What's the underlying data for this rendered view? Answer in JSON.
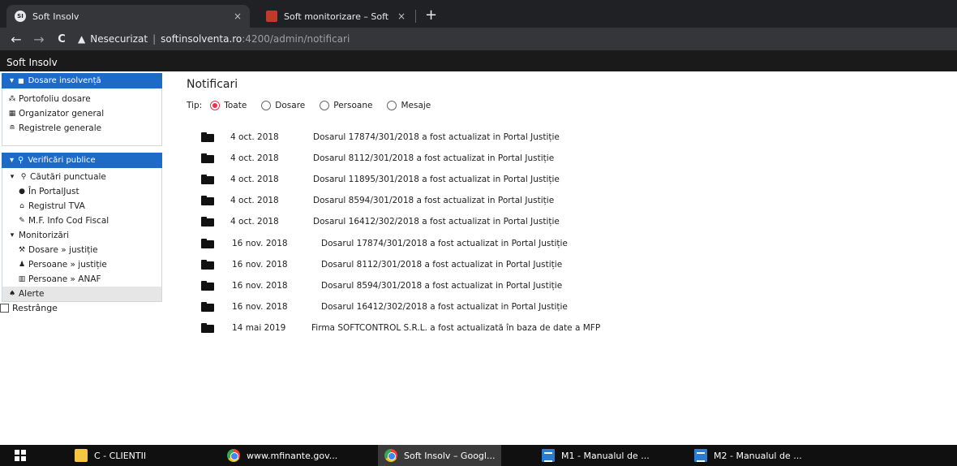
{
  "browser": {
    "tabs": [
      {
        "label": "Soft Insolv",
        "favicon": "softinsolv-favicon",
        "active": true
      },
      {
        "label": "Soft monitorizare – Soft Insolvent",
        "favicon": "monitor-favicon",
        "active": false
      }
    ],
    "new_tab": "+",
    "tab_close": "×",
    "back": "←",
    "forward": "→",
    "reload": "C",
    "security_label": "Nesecurizat",
    "url_host": "softinsolventa.ro",
    "url_path": ":4200/admin/notificari"
  },
  "app": {
    "title": "Soft Insolv"
  },
  "sidebar": {
    "section1": {
      "label": "Dosare insolvență",
      "items": [
        {
          "label": "Portofoliu dosare",
          "icon": "portfolio-icon"
        },
        {
          "label": "Organizator general",
          "icon": "calendar-icon"
        },
        {
          "label": "Registrele generale",
          "icon": "registry-icon"
        }
      ]
    },
    "section2": {
      "label": "Verificări publice"
    },
    "cautari": {
      "label": "Căutări punctuale",
      "items": [
        {
          "label": "În PortalJust",
          "icon": "pin-icon"
        },
        {
          "label": "Registrul TVA",
          "icon": "bank-icon"
        },
        {
          "label": "M.F. Info Cod Fiscal",
          "icon": "pencil-icon"
        }
      ]
    },
    "monitorizari": {
      "label": "Monitorizări",
      "items": [
        {
          "label": "Dosare » justiție",
          "icon": "gavel-icon"
        },
        {
          "label": "Persoane » justiție",
          "icon": "user-icon"
        },
        {
          "label": "Persoane » ANAF",
          "icon": "building-icon"
        }
      ]
    },
    "alerte": {
      "label": "Alerte",
      "icon": "bell-icon"
    },
    "restrange": "Restrânge"
  },
  "main": {
    "title": "Notificari",
    "filter_label": "Tip:",
    "filter_options": [
      {
        "label": "Toate",
        "selected": true
      },
      {
        "label": "Dosare",
        "selected": false
      },
      {
        "label": "Persoane",
        "selected": false
      },
      {
        "label": "Mesaje",
        "selected": false
      }
    ],
    "notifications": [
      {
        "date": "4 oct. 2018",
        "text": "Dosarul 17874/301/2018 a fost actualizat in Portal Justiție"
      },
      {
        "date": "4 oct. 2018",
        "text": "Dosarul 8112/301/2018 a fost actualizat in Portal Justiție"
      },
      {
        "date": "4 oct. 2018",
        "text": "Dosarul 11895/301/2018 a fost actualizat in Portal Justiție"
      },
      {
        "date": "4 oct. 2018",
        "text": "Dosarul 8594/301/2018 a fost actualizat in Portal Justiție"
      },
      {
        "date": "4 oct. 2018",
        "text": "Dosarul 16412/302/2018 a fost actualizat in Portal Justiție"
      },
      {
        "date": "16 nov. 2018",
        "text": "Dosarul 17874/301/2018 a fost actualizat in Portal Justiție"
      },
      {
        "date": "16 nov. 2018",
        "text": "Dosarul 8112/301/2018 a fost actualizat in Portal Justiție"
      },
      {
        "date": "16 nov. 2018",
        "text": "Dosarul 8594/301/2018 a fost actualizat in Portal Justiție"
      },
      {
        "date": "16 nov. 2018",
        "text": "Dosarul 16412/302/2018 a fost actualizat in Portal Justiție"
      },
      {
        "date": "14 mai 2019",
        "text": "Firma SOFTCONTROL S.R.L. a fost actualizată în baza de date a MFP"
      }
    ]
  },
  "taskbar": {
    "items": [
      {
        "label": "C - CLIENTII",
        "icon": "folder-icon"
      },
      {
        "label": "www.mfinante.gov...",
        "icon": "chrome-icon"
      },
      {
        "label": "Soft Insolv – Googl...",
        "icon": "chrome-icon"
      },
      {
        "label": "M1 - Manualul de ...",
        "icon": "document-icon"
      },
      {
        "label": "M2 - Manualul de ...",
        "icon": "document-icon"
      }
    ]
  },
  "colors": {
    "accent": "#1e6bc7",
    "radio_selected": "#e8314e",
    "header_bg": "#1a1a1a"
  }
}
